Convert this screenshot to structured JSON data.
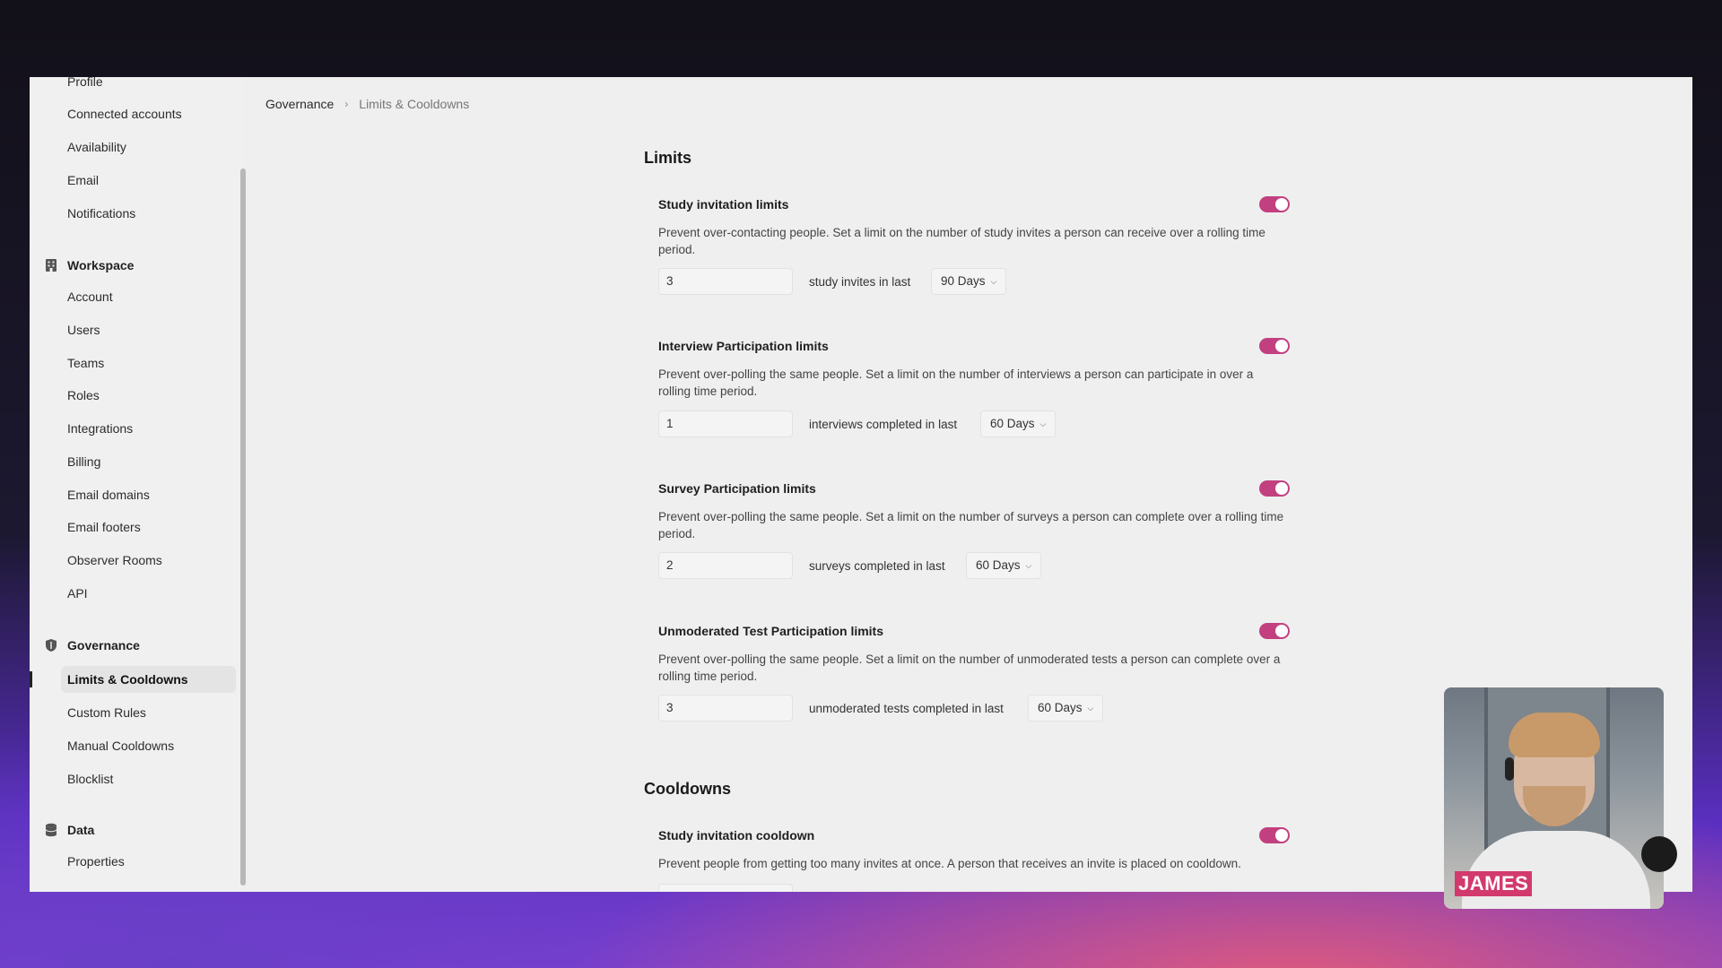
{
  "sidebar": {
    "account_items": [
      {
        "label": "Profile"
      },
      {
        "label": "Connected accounts"
      },
      {
        "label": "Availability"
      },
      {
        "label": "Email"
      },
      {
        "label": "Notifications"
      }
    ],
    "workspace": {
      "title": "Workspace",
      "items": [
        {
          "label": "Account"
        },
        {
          "label": "Users"
        },
        {
          "label": "Teams"
        },
        {
          "label": "Roles"
        },
        {
          "label": "Integrations"
        },
        {
          "label": "Billing"
        },
        {
          "label": "Email domains"
        },
        {
          "label": "Email footers"
        },
        {
          "label": "Observer Rooms"
        },
        {
          "label": "API"
        }
      ]
    },
    "governance": {
      "title": "Governance",
      "items": [
        {
          "label": "Limits & Cooldowns"
        },
        {
          "label": "Custom Rules"
        },
        {
          "label": "Manual Cooldowns"
        },
        {
          "label": "Blocklist"
        }
      ]
    },
    "data": {
      "title": "Data",
      "items": [
        {
          "label": "Properties"
        }
      ]
    }
  },
  "breadcrumb": {
    "parent": "Governance",
    "separator": "›",
    "current": "Limits & Cooldowns"
  },
  "limits": {
    "heading": "Limits",
    "cards": [
      {
        "title": "Study invitation limits",
        "description": "Prevent over-contacting people. Set a limit on the number of study invites a person can receive over a rolling time period.",
        "value": "3",
        "suffix": "study invites in last",
        "period": "90 Days",
        "enabled": true
      },
      {
        "title": "Interview Participation limits",
        "description": "Prevent over-polling the same people. Set a limit on the number of interviews a person can participate in over a rolling time period.",
        "value": "1",
        "suffix": "interviews completed in last",
        "period": "60 Days",
        "enabled": true
      },
      {
        "title": "Survey Participation limits",
        "description": "Prevent over-polling the same people. Set a limit on the number of surveys a person can complete over a rolling time period.",
        "value": "2",
        "suffix": "surveys completed in last",
        "period": "60 Days",
        "enabled": true
      },
      {
        "title": "Unmoderated Test Participation limits",
        "description": "Prevent over-polling the same people. Set a limit on the number of unmoderated tests a person can complete over a rolling time period.",
        "value": "3",
        "suffix": "unmoderated tests completed in last",
        "period": "60 Days",
        "enabled": true
      }
    ]
  },
  "cooldowns": {
    "heading": "Cooldowns",
    "cards": [
      {
        "title": "Study invitation cooldown",
        "description": "Prevent people from getting too many invites at once. A person that receives an invite is placed on cooldown.",
        "enabled": true
      }
    ]
  },
  "video_overlay": {
    "name_tag": "JAMES"
  },
  "colors": {
    "toggle_on": "#c2407f",
    "name_tag": "#d23a6e"
  },
  "icons": {
    "workspace": "building-icon",
    "governance": "shield-icon",
    "data": "database-icon",
    "dropdown": "chevron-down-icon"
  }
}
